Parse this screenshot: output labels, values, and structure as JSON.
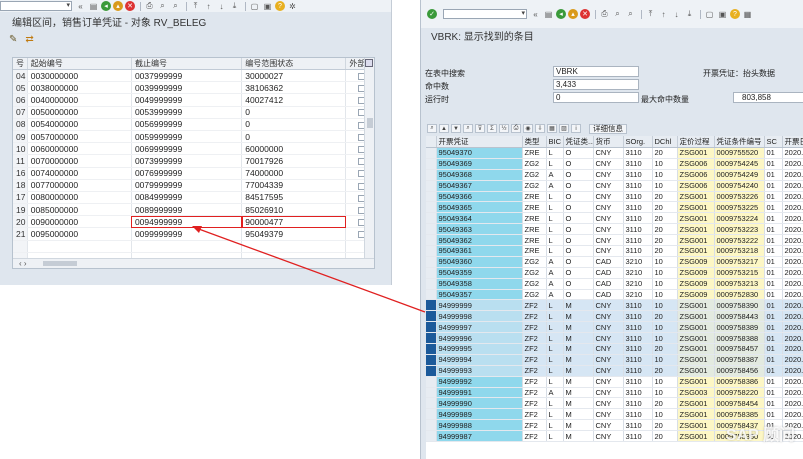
{
  "left": {
    "title": "编辑区间，销售订单凭证 - 对象 RV_BELEG",
    "columns": [
      "号",
      "起始编号",
      "截止编号",
      "编号范围状态",
      "外部"
    ],
    "rows": [
      {
        "no": "04",
        "from": "0030000000",
        "to": "0037999999",
        "status": "30000027"
      },
      {
        "no": "05",
        "from": "0038000000",
        "to": "0039999999",
        "status": "38106362"
      },
      {
        "no": "06",
        "from": "0040000000",
        "to": "0049999999",
        "status": "40027412"
      },
      {
        "no": "07",
        "from": "0050000000",
        "to": "0053999999",
        "status": "0"
      },
      {
        "no": "08",
        "from": "0054000000",
        "to": "0056999999",
        "status": "0"
      },
      {
        "no": "09",
        "from": "0057000000",
        "to": "0059999999",
        "status": "0"
      },
      {
        "no": "10",
        "from": "0060000000",
        "to": "0069999999",
        "status": "60000000"
      },
      {
        "no": "11",
        "from": "0070000000",
        "to": "0073999999",
        "status": "70017926"
      },
      {
        "no": "16",
        "from": "0074000000",
        "to": "0076999999",
        "status": "74000000"
      },
      {
        "no": "18",
        "from": "0077000000",
        "to": "0079999999",
        "status": "77004339"
      },
      {
        "no": "17",
        "from": "0080000000",
        "to": "0084999999",
        "status": "84517595"
      },
      {
        "no": "19",
        "from": "0085000000",
        "to": "0089999999",
        "status": "85026910"
      },
      {
        "no": "20",
        "from": "0090000000",
        "to": "0094999999",
        "status": "90000477"
      },
      {
        "no": "21",
        "from": "0095000000",
        "to": "0099999999",
        "status": "95049379"
      }
    ]
  },
  "right": {
    "title": "VBRK: 显示找到的条目",
    "selection": {
      "table_label": "在表中搜索",
      "table_value": "VBRK",
      "table_note": "开票凭证：抬头数据",
      "hits_label": "命中数",
      "hits_value": "3,433",
      "runtime_label": "运行时",
      "runtime_value": "0",
      "max_label": "最大命中数量",
      "max_value": "803,858"
    },
    "detail_button": "详细信息",
    "columns": [
      "开票凭证",
      "类型",
      "BIC",
      "凭证类...",
      "货币",
      "SOrg.",
      "DChl",
      "定价过程",
      "凭证条件编号",
      "SC",
      "开票日"
    ],
    "rows": [
      {
        "doc": "95049370",
        "type": "ZRE",
        "bic": "L",
        "cat": "O",
        "cur": "CNY",
        "sorg": "3110",
        "dchl": "20",
        "proc": "ZSG001",
        "cond": "0009755520",
        "sc": "01",
        "date": "2020."
      },
      {
        "doc": "95049369",
        "type": "ZG2",
        "bic": "L",
        "cat": "O",
        "cur": "CNY",
        "sorg": "3110",
        "dchl": "10",
        "proc": "ZSG006",
        "cond": "0009754245",
        "sc": "01",
        "date": "2020."
      },
      {
        "doc": "95049368",
        "type": "ZG2",
        "bic": "A",
        "cat": "O",
        "cur": "CNY",
        "sorg": "3110",
        "dchl": "10",
        "proc": "ZSG006",
        "cond": "0009754249",
        "sc": "01",
        "date": "2020."
      },
      {
        "doc": "95049367",
        "type": "ZG2",
        "bic": "A",
        "cat": "O",
        "cur": "CNY",
        "sorg": "3110",
        "dchl": "10",
        "proc": "ZSG006",
        "cond": "0009754240",
        "sc": "01",
        "date": "2020."
      },
      {
        "doc": "95049366",
        "type": "ZRE",
        "bic": "L",
        "cat": "O",
        "cur": "CNY",
        "sorg": "3110",
        "dchl": "20",
        "proc": "ZSG001",
        "cond": "0009753226",
        "sc": "01",
        "date": "2020."
      },
      {
        "doc": "95049365",
        "type": "ZRE",
        "bic": "L",
        "cat": "O",
        "cur": "CNY",
        "sorg": "3110",
        "dchl": "20",
        "proc": "ZSG001",
        "cond": "0009753225",
        "sc": "01",
        "date": "2020."
      },
      {
        "doc": "95049364",
        "type": "ZRE",
        "bic": "L",
        "cat": "O",
        "cur": "CNY",
        "sorg": "3110",
        "dchl": "20",
        "proc": "ZSG001",
        "cond": "0009753224",
        "sc": "01",
        "date": "2020."
      },
      {
        "doc": "95049363",
        "type": "ZRE",
        "bic": "L",
        "cat": "O",
        "cur": "CNY",
        "sorg": "3110",
        "dchl": "20",
        "proc": "ZSG001",
        "cond": "0009753223",
        "sc": "01",
        "date": "2020."
      },
      {
        "doc": "95049362",
        "type": "ZRE",
        "bic": "L",
        "cat": "O",
        "cur": "CNY",
        "sorg": "3110",
        "dchl": "20",
        "proc": "ZSG001",
        "cond": "0009753222",
        "sc": "01",
        "date": "2020."
      },
      {
        "doc": "95049361",
        "type": "ZRE",
        "bic": "L",
        "cat": "O",
        "cur": "CNY",
        "sorg": "3110",
        "dchl": "20",
        "proc": "ZSG001",
        "cond": "0009753218",
        "sc": "01",
        "date": "2020."
      },
      {
        "doc": "95049360",
        "type": "ZG2",
        "bic": "A",
        "cat": "O",
        "cur": "CAD",
        "sorg": "3210",
        "dchl": "10",
        "proc": "ZSG009",
        "cond": "0009753217",
        "sc": "01",
        "date": "2020."
      },
      {
        "doc": "95049359",
        "type": "ZG2",
        "bic": "A",
        "cat": "O",
        "cur": "CAD",
        "sorg": "3210",
        "dchl": "10",
        "proc": "ZSG009",
        "cond": "0009753215",
        "sc": "01",
        "date": "2020."
      },
      {
        "doc": "95049358",
        "type": "ZG2",
        "bic": "A",
        "cat": "O",
        "cur": "CAD",
        "sorg": "3210",
        "dchl": "10",
        "proc": "ZSG009",
        "cond": "0009753213",
        "sc": "01",
        "date": "2020."
      },
      {
        "doc": "95049357",
        "type": "ZG2",
        "bic": "A",
        "cat": "O",
        "cur": "CAD",
        "sorg": "3210",
        "dchl": "10",
        "proc": "ZSG009",
        "cond": "0009752830",
        "sc": "01",
        "date": "2020."
      },
      {
        "doc": "94999999",
        "type": "ZF2",
        "bic": "L",
        "cat": "M",
        "cur": "CNY",
        "sorg": "3110",
        "dchl": "10",
        "proc": "ZSG001",
        "cond": "0009758390",
        "sc": "01",
        "date": "2020.",
        "marked": true
      },
      {
        "doc": "94999998",
        "type": "ZF2",
        "bic": "L",
        "cat": "M",
        "cur": "CNY",
        "sorg": "3110",
        "dchl": "20",
        "proc": "ZSG001",
        "cond": "0009758443",
        "sc": "01",
        "date": "2020.",
        "marked": true
      },
      {
        "doc": "94999997",
        "type": "ZF2",
        "bic": "L",
        "cat": "M",
        "cur": "CNY",
        "sorg": "3110",
        "dchl": "10",
        "proc": "ZSG001",
        "cond": "0009758389",
        "sc": "01",
        "date": "2020.",
        "marked": true
      },
      {
        "doc": "94999996",
        "type": "ZF2",
        "bic": "L",
        "cat": "M",
        "cur": "CNY",
        "sorg": "3110",
        "dchl": "10",
        "proc": "ZSG001",
        "cond": "0009758388",
        "sc": "01",
        "date": "2020.",
        "marked": true
      },
      {
        "doc": "94999995",
        "type": "ZF2",
        "bic": "L",
        "cat": "M",
        "cur": "CNY",
        "sorg": "3110",
        "dchl": "20",
        "proc": "ZSG001",
        "cond": "0009758457",
        "sc": "01",
        "date": "2020.",
        "marked": true
      },
      {
        "doc": "94999994",
        "type": "ZF2",
        "bic": "L",
        "cat": "M",
        "cur": "CNY",
        "sorg": "3110",
        "dchl": "10",
        "proc": "ZSG001",
        "cond": "0009758387",
        "sc": "01",
        "date": "2020.",
        "marked": true
      },
      {
        "doc": "94999993",
        "type": "ZF2",
        "bic": "L",
        "cat": "M",
        "cur": "CNY",
        "sorg": "3110",
        "dchl": "20",
        "proc": "ZSG001",
        "cond": "0009758456",
        "sc": "01",
        "date": "2020.",
        "marked": true
      },
      {
        "doc": "94999992",
        "type": "ZF2",
        "bic": "L",
        "cat": "M",
        "cur": "CNY",
        "sorg": "3110",
        "dchl": "10",
        "proc": "ZSG001",
        "cond": "0009758386",
        "sc": "01",
        "date": "2020."
      },
      {
        "doc": "94999991",
        "type": "ZF2",
        "bic": "A",
        "cat": "M",
        "cur": "CNY",
        "sorg": "3110",
        "dchl": "10",
        "proc": "ZSG003",
        "cond": "0009758220",
        "sc": "01",
        "date": "2020."
      },
      {
        "doc": "94999990",
        "type": "ZF2",
        "bic": "L",
        "cat": "M",
        "cur": "CNY",
        "sorg": "3110",
        "dchl": "20",
        "proc": "ZSG001",
        "cond": "0009758454",
        "sc": "01",
        "date": "2020."
      },
      {
        "doc": "94999989",
        "type": "ZF2",
        "bic": "L",
        "cat": "M",
        "cur": "CNY",
        "sorg": "3110",
        "dchl": "10",
        "proc": "ZSG001",
        "cond": "0009758385",
        "sc": "01",
        "date": "2020."
      },
      {
        "doc": "94999988",
        "type": "ZF2",
        "bic": "L",
        "cat": "M",
        "cur": "CNY",
        "sorg": "3110",
        "dchl": "20",
        "proc": "ZSG001",
        "cond": "0009758437",
        "sc": "01",
        "date": "2020."
      },
      {
        "doc": "94999987",
        "type": "ZF2",
        "bic": "L",
        "cat": "M",
        "cur": "CNY",
        "sorg": "3110",
        "dchl": "20",
        "proc": "ZSG001",
        "cond": "0009758350",
        "sc": "01",
        "date": "2020."
      }
    ]
  },
  "watermark": "SAP 顾问"
}
